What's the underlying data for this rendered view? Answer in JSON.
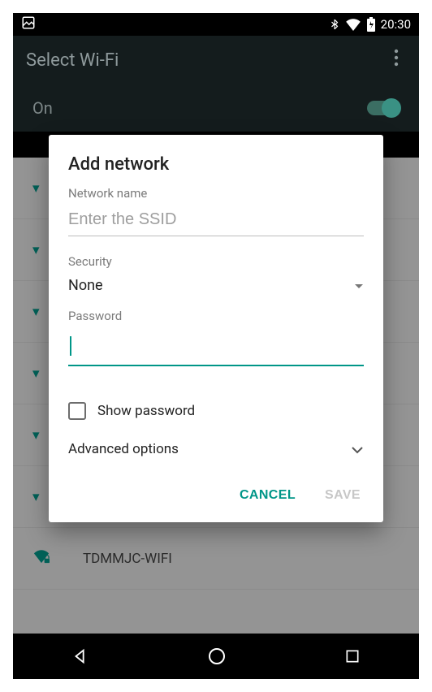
{
  "status_bar": {
    "time": "20:30",
    "icons": [
      "image-icon",
      "bluetooth-icon",
      "wifi-icon",
      "battery-charging-icon"
    ]
  },
  "app_bar": {
    "title": "Select Wi-Fi"
  },
  "wifi_toggle": {
    "label": "On",
    "state": true
  },
  "background_list_item": {
    "ssid": "TDMMJC-WIFI"
  },
  "dialog": {
    "title": "Add network",
    "network_name_label": "Network name",
    "network_name_placeholder": "Enter the SSID",
    "network_name_value": "",
    "security_label": "Security",
    "security_value": "None",
    "password_label": "Password",
    "password_value": "",
    "show_password_label": "Show password",
    "show_password_checked": false,
    "advanced_label": "Advanced options",
    "actions": {
      "cancel": "CANCEL",
      "save": "SAVE"
    }
  }
}
